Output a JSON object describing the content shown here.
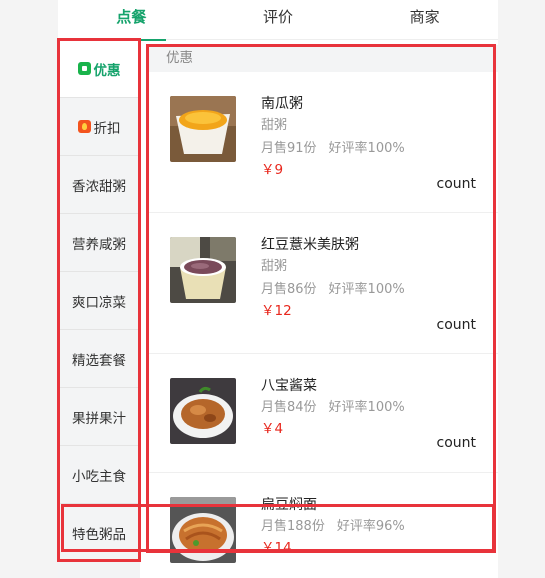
{
  "tabs": [
    {
      "label": "点餐"
    },
    {
      "label": "评价"
    },
    {
      "label": "商家"
    }
  ],
  "menu": [
    {
      "label": "优惠",
      "icon": "discount-icon"
    },
    {
      "label": "折扣",
      "icon": "flame-icon"
    },
    {
      "label": "香浓甜粥"
    },
    {
      "label": "营养咸粥"
    },
    {
      "label": "爽口凉菜"
    },
    {
      "label": "精选套餐"
    },
    {
      "label": "果拼果汁"
    },
    {
      "label": "小吃主食"
    },
    {
      "label": "特色粥品"
    }
  ],
  "section": {
    "title": "优惠"
  },
  "foods": [
    {
      "name": "南瓜粥",
      "desc": "甜粥",
      "sales": "月售91份",
      "rating": "好评率100%",
      "price": "￥9",
      "count_label": "count"
    },
    {
      "name": "红豆薏米美肤粥",
      "desc": "甜粥",
      "sales": "月售86份",
      "rating": "好评率100%",
      "price": "￥12",
      "count_label": "count"
    },
    {
      "name": "八宝酱菜",
      "sales": "月售84份",
      "rating": "好评率100%",
      "price": "￥4",
      "count_label": "count"
    },
    {
      "name": "扁豆焖面",
      "sales": "月售188份",
      "rating": "好评率96%",
      "price": "￥14"
    }
  ],
  "colors": {
    "accent": "#16a36c",
    "price": "#e8271d",
    "annotation": "#e8333b"
  }
}
